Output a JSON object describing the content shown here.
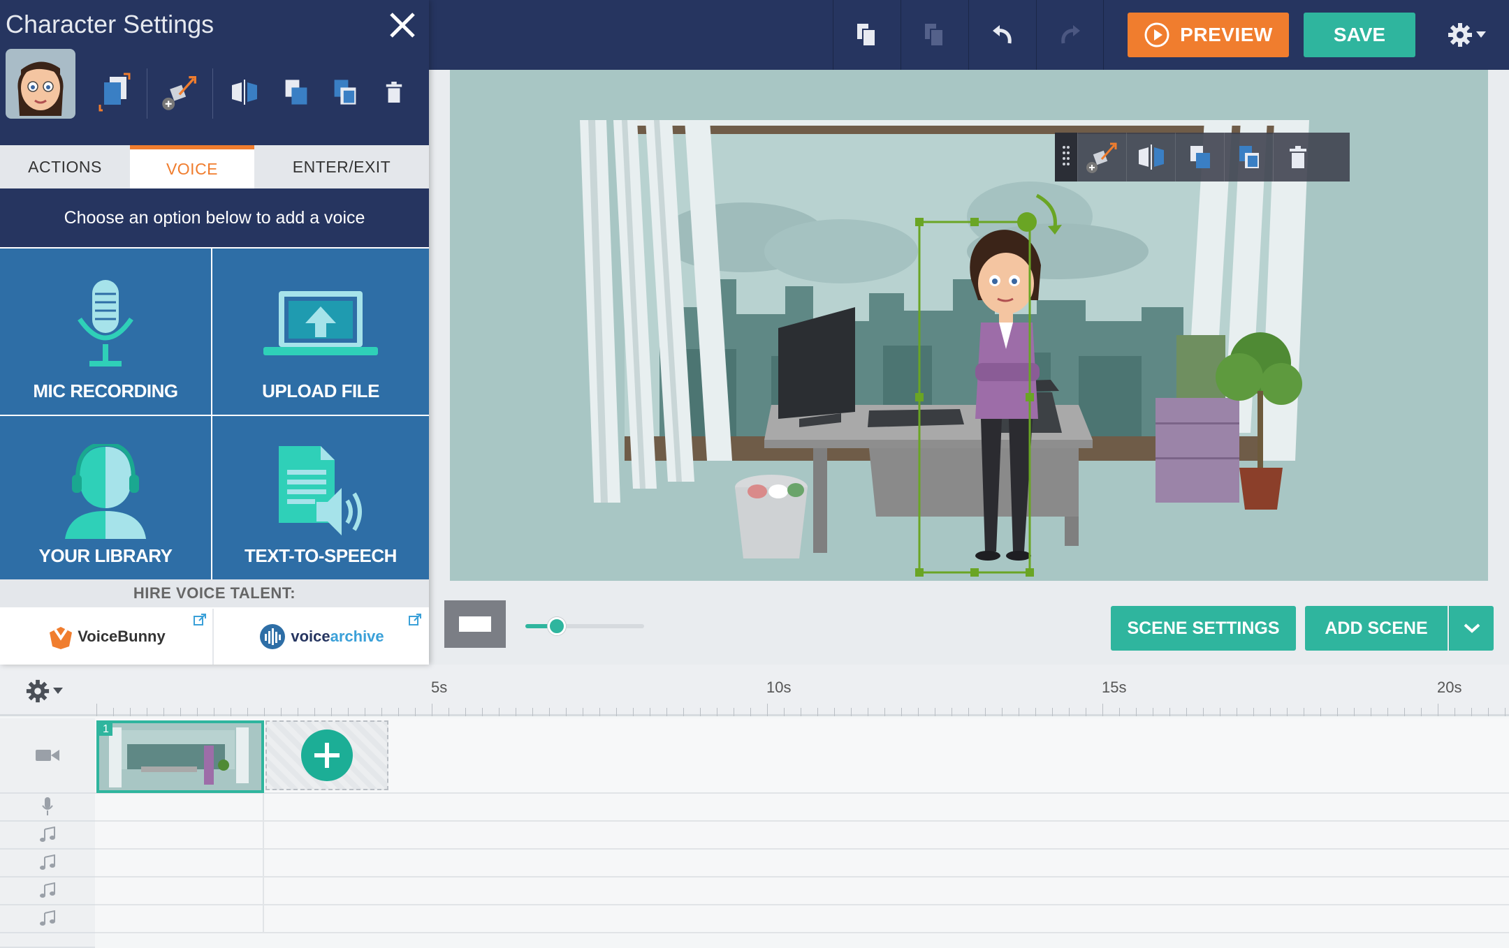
{
  "panel": {
    "title": "Character Settings",
    "tabs": [
      {
        "label": "ACTIONS"
      },
      {
        "label": "VOICE"
      },
      {
        "label": "ENTER/EXIT"
      }
    ],
    "prompt": "Choose an option below to add a voice",
    "tiles": [
      {
        "label": "MIC RECORDING",
        "icon": "microphone-icon"
      },
      {
        "label": "UPLOAD FILE",
        "icon": "laptop-upload-icon"
      },
      {
        "label": "YOUR LIBRARY",
        "icon": "user-headphones-icon"
      },
      {
        "label": "TEXT-TO-SPEECH",
        "icon": "document-speaker-icon"
      }
    ],
    "hire_label": "HIRE VOICE TALENT:",
    "talent": [
      {
        "name": "VoiceBunny"
      },
      {
        "name_a": "voice",
        "name_b": "archive"
      }
    ]
  },
  "toolbar": {
    "preview_label": "PREVIEW",
    "save_label": "SAVE"
  },
  "stage_controls": {
    "scene_settings_label": "SCENE SETTINGS",
    "add_scene_label": "ADD SCENE",
    "zoom_level": 0.2
  },
  "timeline": {
    "ruler": [
      "5s",
      "10s",
      "15s",
      "20s"
    ],
    "scene_number": "1"
  },
  "colors": {
    "navy": "#263560",
    "teal": "#2fb59e",
    "orange": "#f07d2e",
    "tile_blue": "#2e6ea6"
  }
}
